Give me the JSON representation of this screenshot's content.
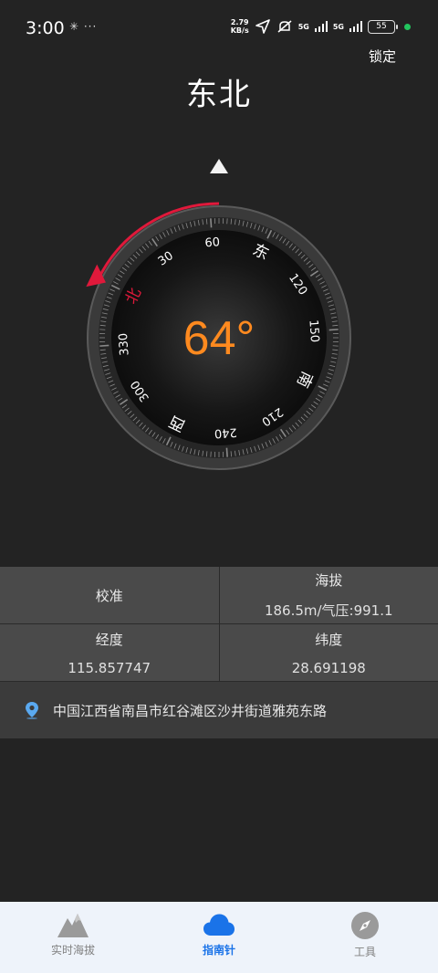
{
  "status_bar": {
    "time": "3:00",
    "left_icons": "✳ ···",
    "net_speed_value": "2.79",
    "net_speed_unit": "KB/s",
    "signal1": "5G",
    "signal2": "5G",
    "battery": "55",
    "icons": [
      "location-arrow-icon",
      "mute-icon",
      "signal-icon",
      "battery-icon"
    ]
  },
  "header": {
    "lock_label": "锁定",
    "direction": "东北"
  },
  "compass": {
    "heading_degrees": 64,
    "heading_text": "64°",
    "ticks": [
      {
        "label": "北",
        "deg": 0,
        "red": true
      },
      {
        "label": "30",
        "deg": 30
      },
      {
        "label": "60",
        "deg": 60
      },
      {
        "label": "东",
        "deg": 90
      },
      {
        "label": "120",
        "deg": 120
      },
      {
        "label": "150",
        "deg": 150
      },
      {
        "label": "南",
        "deg": 180
      },
      {
        "label": "210",
        "deg": 210
      },
      {
        "label": "240",
        "deg": 240
      },
      {
        "label": "西",
        "deg": 270
      },
      {
        "label": "300",
        "deg": 300
      },
      {
        "label": "330",
        "deg": 330
      }
    ],
    "colors": {
      "accent": "#ff8a1f",
      "north": "#e0193b"
    }
  },
  "info": {
    "calibrate": "校准",
    "altitude_label": "海拔",
    "altitude_value": "186.5m/气压:991.1",
    "longitude_label": "经度",
    "longitude_value": "115.857747",
    "latitude_label": "纬度",
    "latitude_value": "28.691198",
    "address": "中国江西省南昌市红谷滩区沙井街道雅苑东路"
  },
  "nav": {
    "items": [
      {
        "label": "实时海拔",
        "icon": "mountain-icon",
        "active": false
      },
      {
        "label": "指南针",
        "icon": "cloud-icon",
        "active": true
      },
      {
        "label": "工具",
        "icon": "compass-icon",
        "active": false
      }
    ],
    "colors": {
      "active": "#1a73e8",
      "inactive": "#808080"
    }
  }
}
